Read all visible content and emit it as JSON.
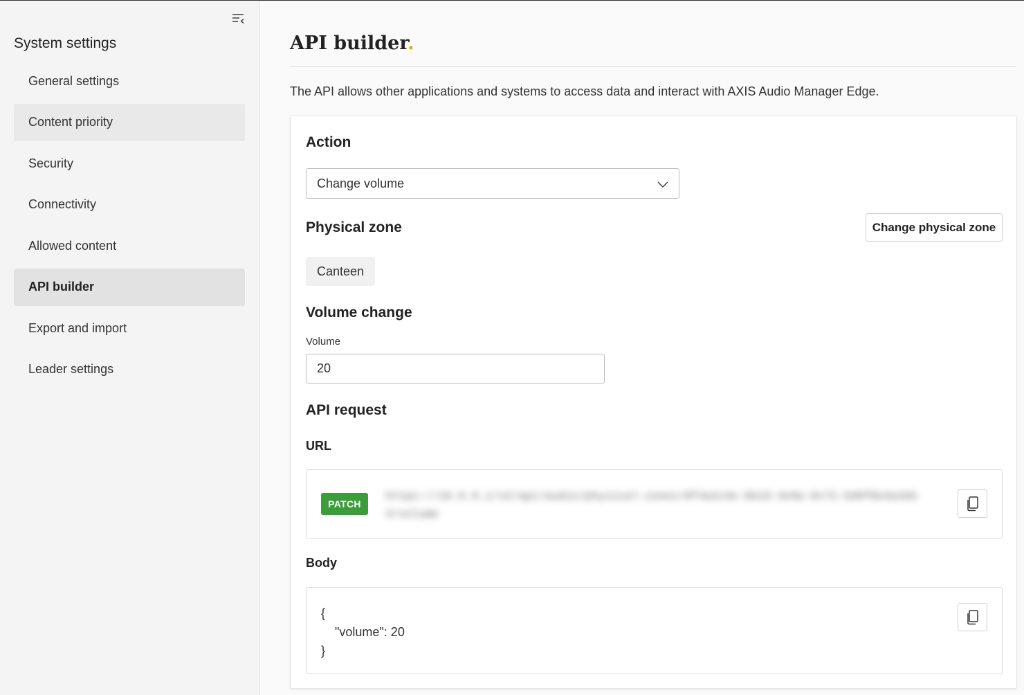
{
  "sidebar": {
    "title": "System settings",
    "items": [
      {
        "label": "General settings"
      },
      {
        "label": "Content priority"
      },
      {
        "label": "Security"
      },
      {
        "label": "Connectivity"
      },
      {
        "label": "Allowed content"
      },
      {
        "label": "API builder"
      },
      {
        "label": "Export and import"
      },
      {
        "label": "Leader settings"
      }
    ],
    "hovered_item": "Content priority",
    "active_item": "API builder"
  },
  "main": {
    "title": "API builder",
    "title_dot": ".",
    "description": "The API allows other applications and systems to access data and interact with AXIS Audio Manager Edge.",
    "action": {
      "heading": "Action",
      "selected": "Change volume"
    },
    "physical_zone": {
      "heading": "Physical zone",
      "change_button": "Change physical zone",
      "zone": "Canteen"
    },
    "volume_change": {
      "heading": "Volume change",
      "label": "Volume",
      "value": "20"
    },
    "api_request": {
      "heading": "API request",
      "url_label": "URL",
      "method": "PATCH",
      "url_value": "https://10.0.0.1/v2/api/audio/physical-zones/8f4a2c3e-6b1d-4e9a-9c72-5d0f8e3a1b64/volume",
      "body_label": "Body",
      "body_value": "{\n    \"volume\": 20\n}"
    }
  },
  "colors": {
    "accent_dot": "#e4a400",
    "patch_badge": "#3a9d3a"
  }
}
